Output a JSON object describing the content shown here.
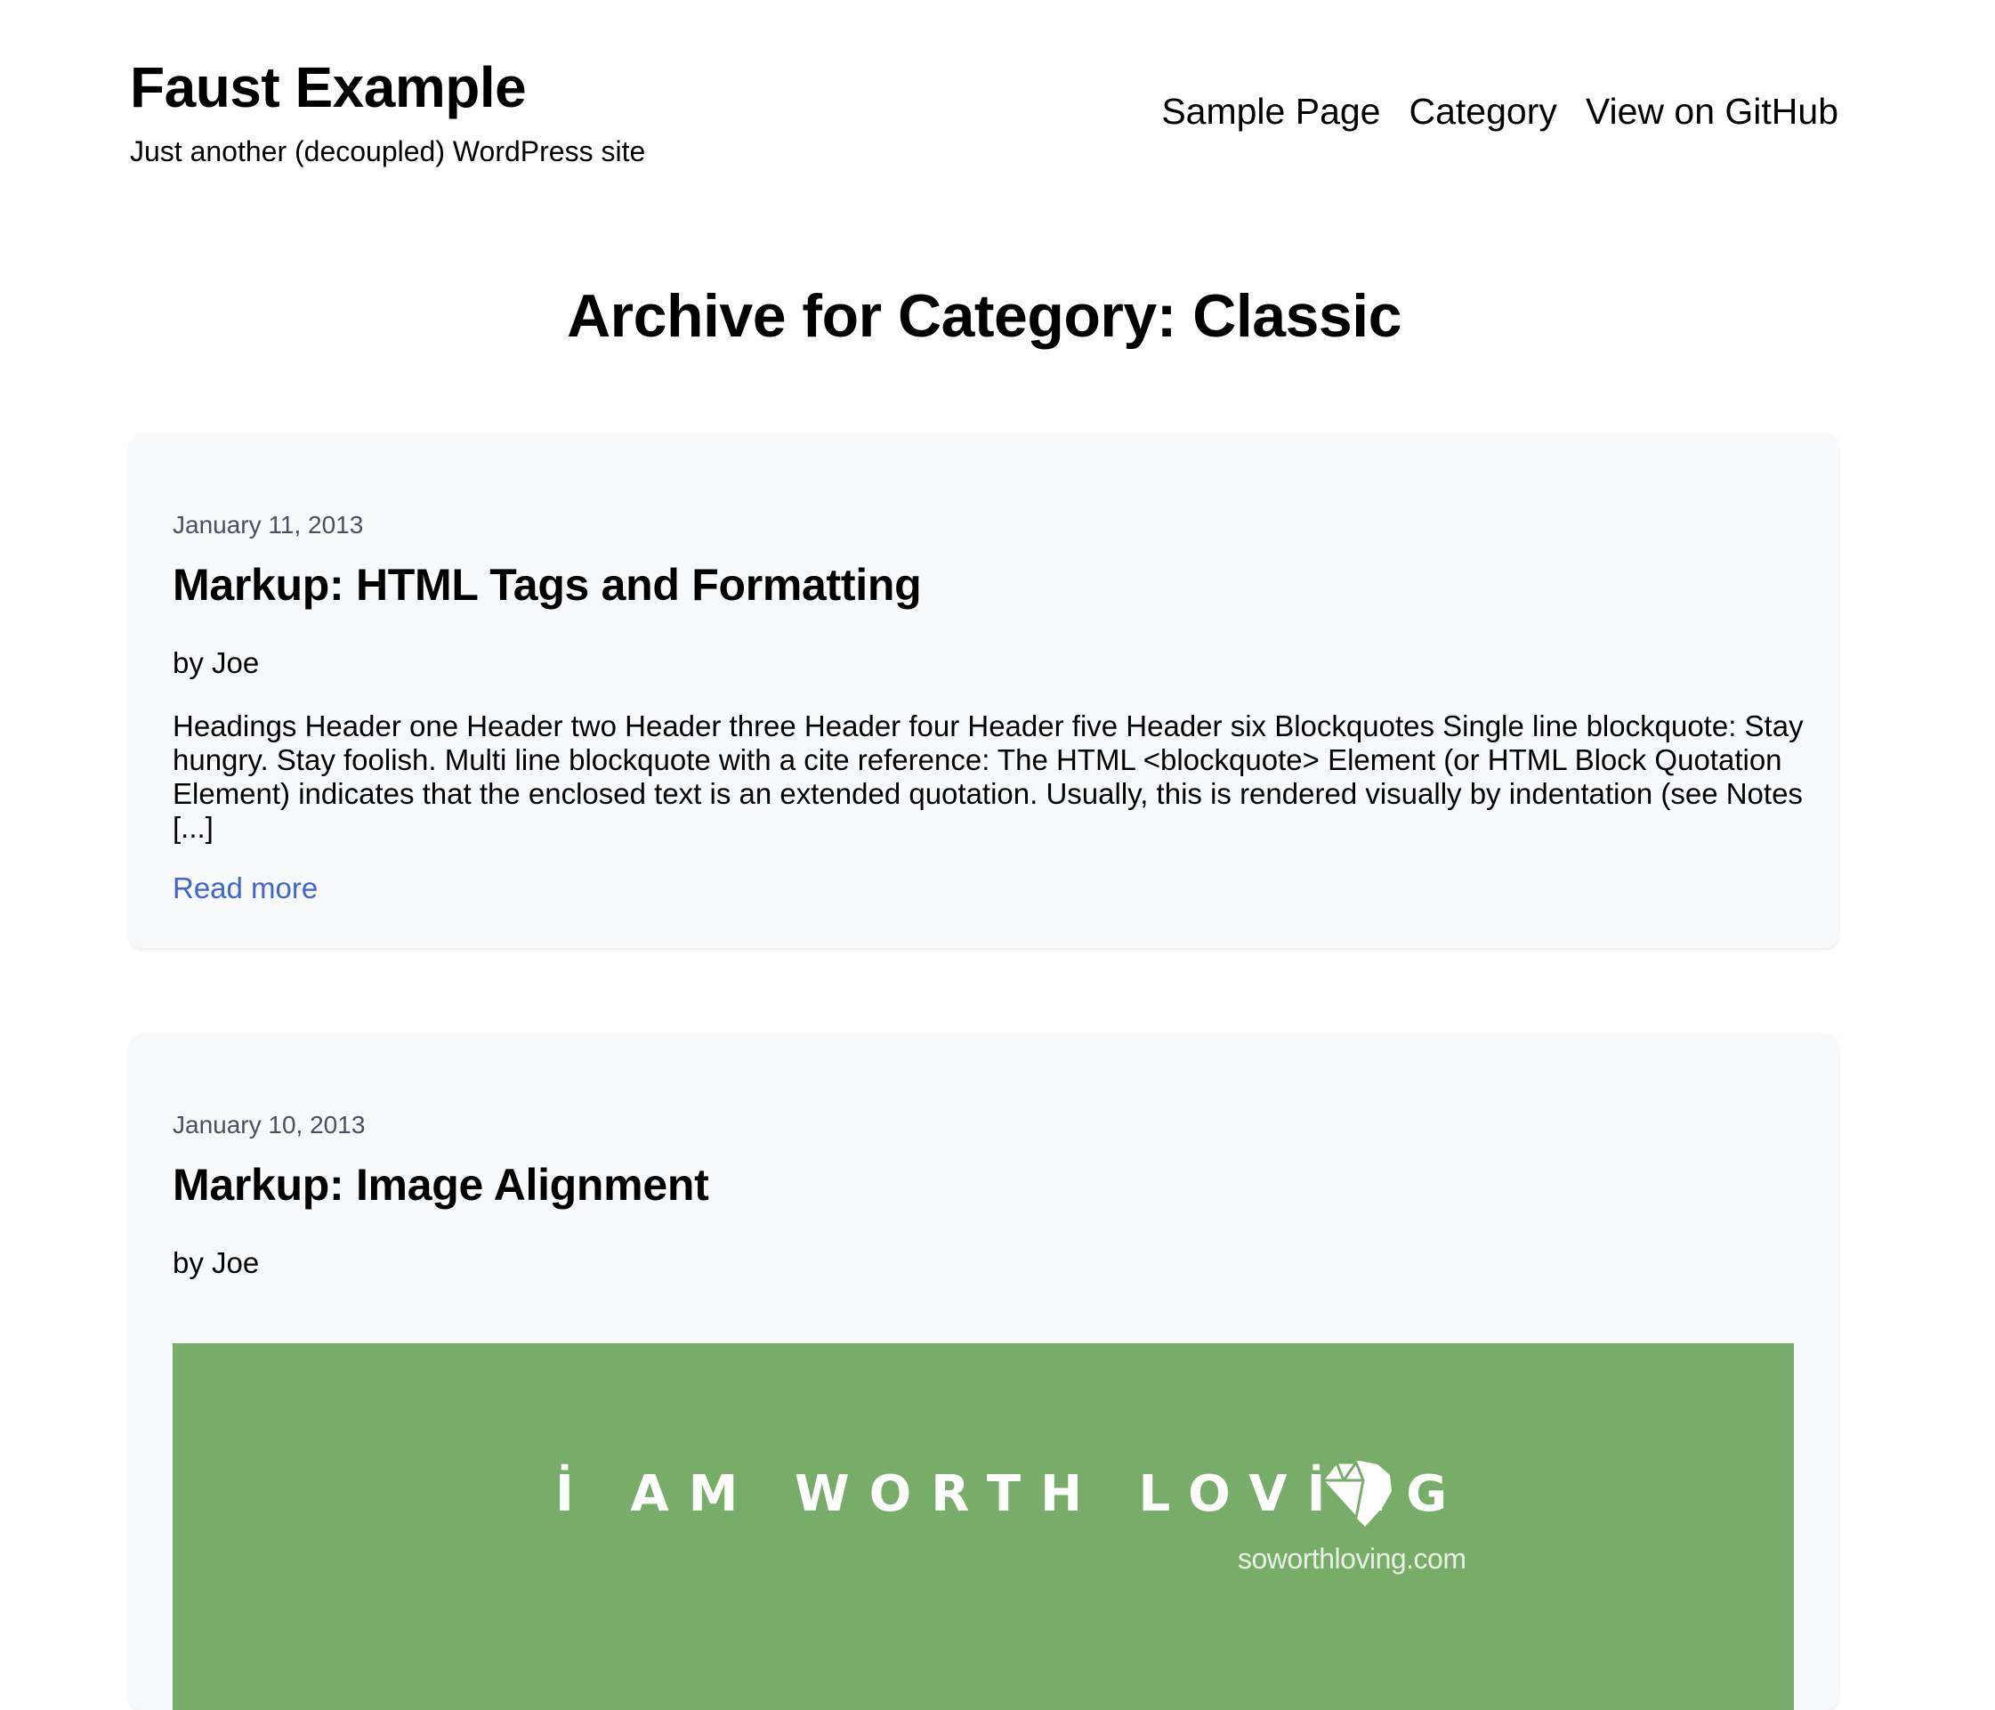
{
  "site": {
    "title": "Faust Example",
    "tagline": "Just another (decoupled) WordPress site"
  },
  "nav": {
    "items": [
      {
        "label": "Sample Page"
      },
      {
        "label": "Category"
      },
      {
        "label": "View on GitHub"
      }
    ]
  },
  "archive": {
    "title": "Archive for Category: Classic"
  },
  "posts": [
    {
      "date": "January 11, 2013",
      "title": "Markup: HTML Tags and Formatting",
      "author": "by Joe",
      "excerpt": "Headings Header one Header two Header three Header four Header five Header six Blockquotes Single line blockquote: Stay hungry. Stay foolish. Multi line blockquote with a cite reference: The HTML <blockquote> Element (or HTML Block Quotation Element) indicates that the enclosed text is an extended quotation. Usually, this is rendered visually by indentation (see Notes [...]",
      "read_more": "Read more"
    },
    {
      "date": "January 10, 2013",
      "title": "Markup: Image Alignment",
      "author": "by Joe",
      "image": {
        "text": "İ AM WORTH LOVİNG",
        "subtext": "soworthloving.com",
        "background_color": "#77ad69",
        "icon": "diamond-heart-icon"
      }
    }
  ],
  "colors": {
    "link": "#4064d0",
    "card_background": "#f8f9fb",
    "meta_text": "#4a5060"
  }
}
